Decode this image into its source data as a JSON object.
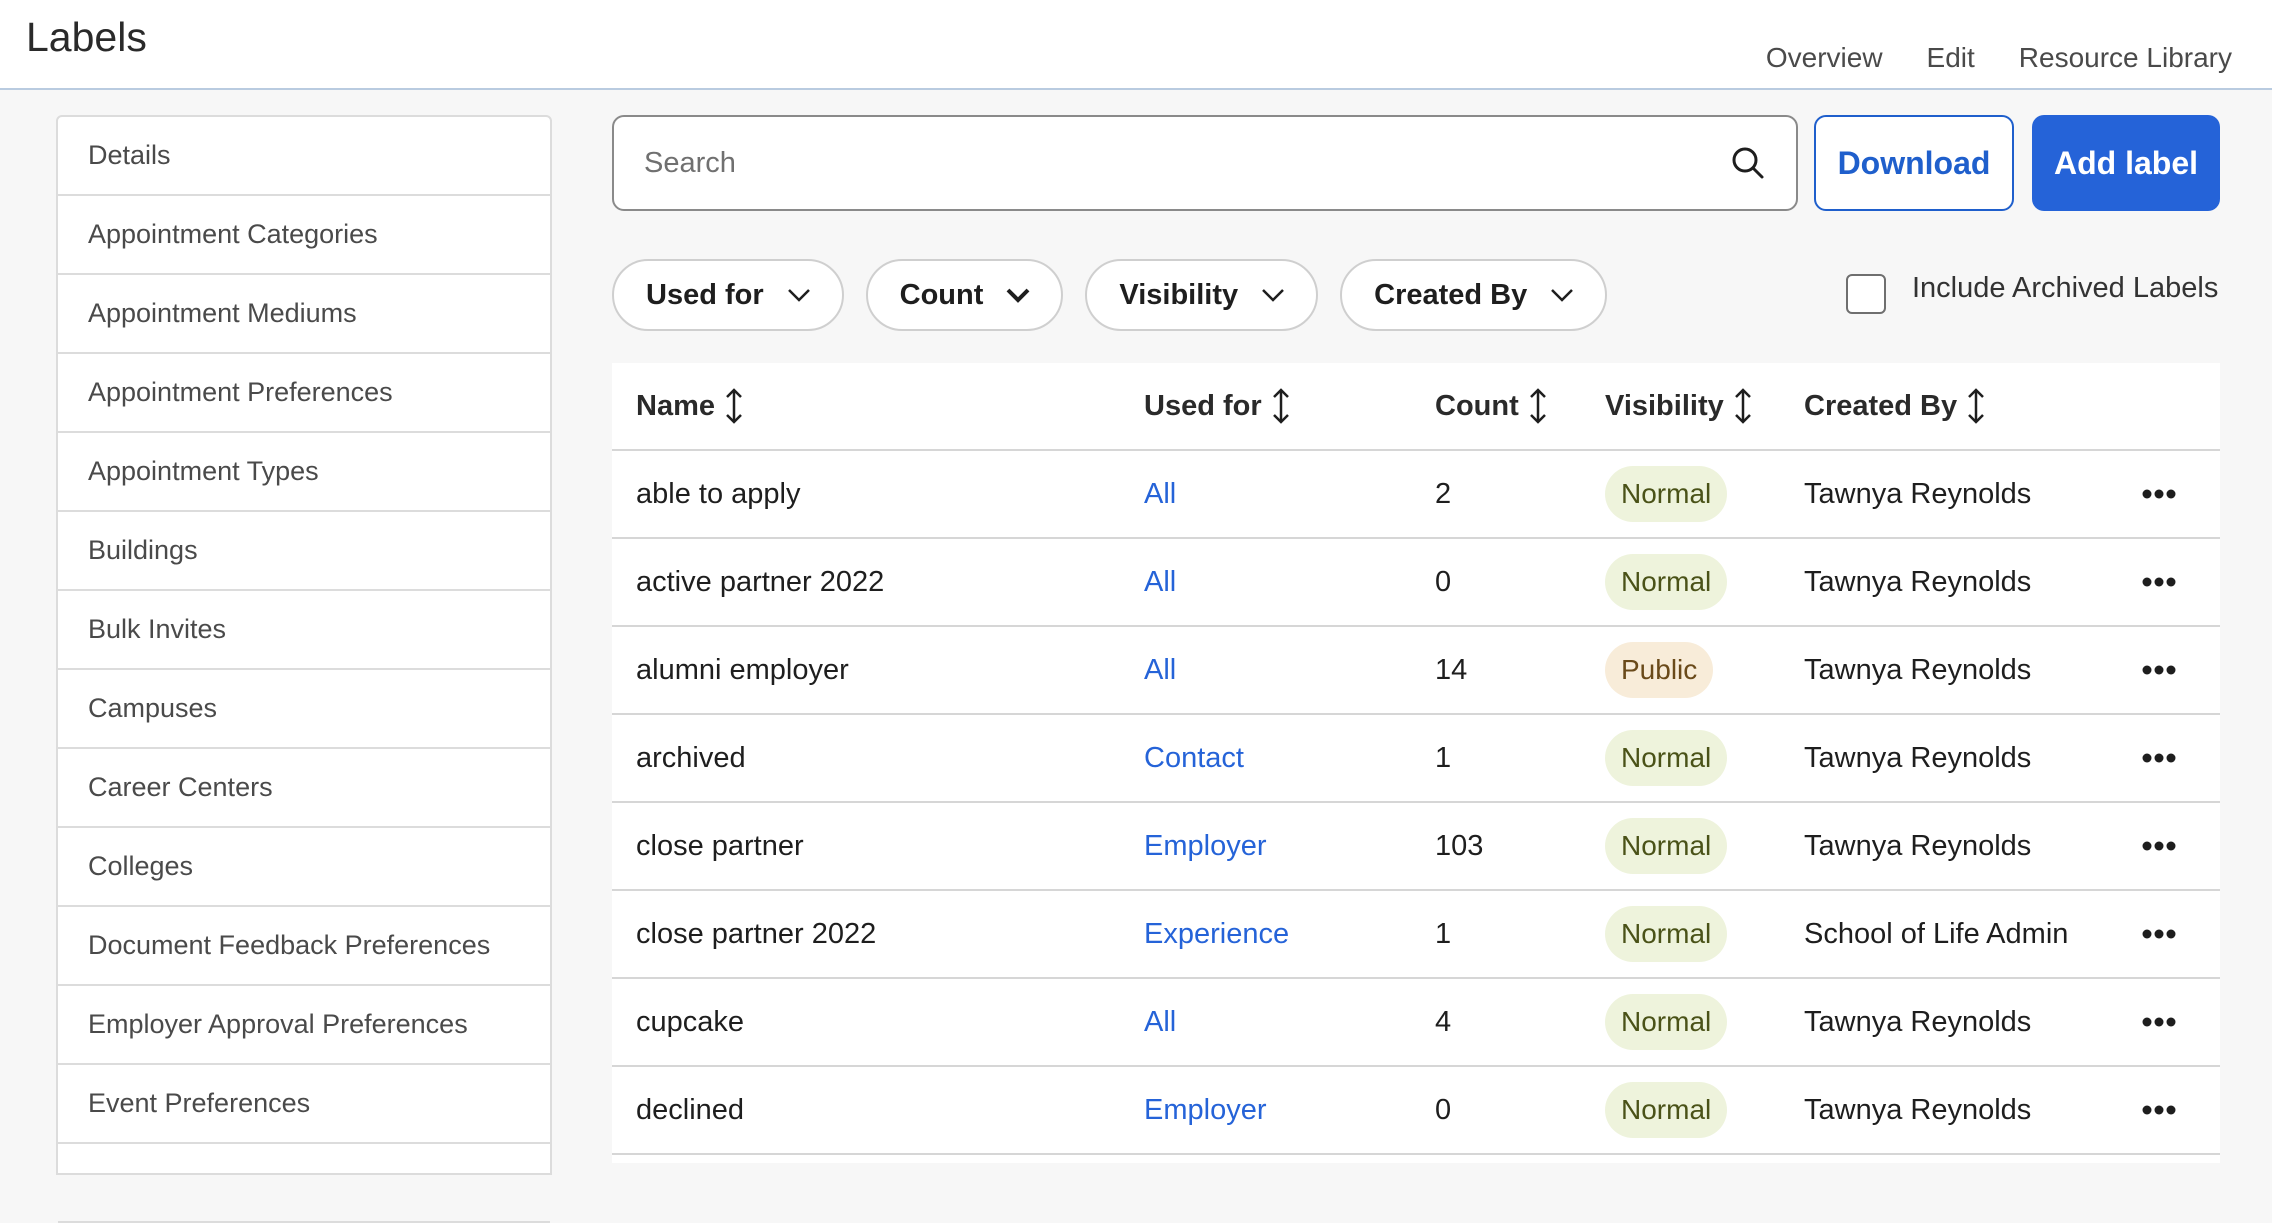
{
  "header": {
    "title": "Labels",
    "nav": [
      "Overview",
      "Edit",
      "Resource Library"
    ]
  },
  "sidebar": {
    "items": [
      "Details",
      "Appointment Categories",
      "Appointment Mediums",
      "Appointment Preferences",
      "Appointment Types",
      "Buildings",
      "Bulk Invites",
      "Campuses",
      "Career Centers",
      "Colleges",
      "Document Feedback Preferences",
      "Employer Approval Preferences",
      "Event Preferences",
      ""
    ]
  },
  "search": {
    "placeholder": "Search",
    "value": ""
  },
  "actions": {
    "download_label": "Download",
    "add_label": "Add label"
  },
  "filters": [
    "Used for",
    "Count",
    "Visibility",
    "Created By"
  ],
  "archived": {
    "label": "Include Archived Labels",
    "checked": false
  },
  "table": {
    "columns": [
      "Name",
      "Used for",
      "Count",
      "Visibility",
      "Created By"
    ],
    "rows": [
      {
        "name": "able to apply",
        "used_for": "All",
        "count": "2",
        "visibility": "Normal",
        "created_by": "Tawnya Reynolds"
      },
      {
        "name": "active partner 2022",
        "used_for": "All",
        "count": "0",
        "visibility": "Normal",
        "created_by": "Tawnya Reynolds"
      },
      {
        "name": "alumni employer",
        "used_for": "All",
        "count": "14",
        "visibility": "Public",
        "created_by": "Tawnya Reynolds"
      },
      {
        "name": "archived",
        "used_for": "Contact",
        "count": "1",
        "visibility": "Normal",
        "created_by": "Tawnya Reynolds"
      },
      {
        "name": "close partner",
        "used_for": "Employer",
        "count": "103",
        "visibility": "Normal",
        "created_by": "Tawnya Reynolds"
      },
      {
        "name": "close partner 2022",
        "used_for": "Experience",
        "count": "1",
        "visibility": "Normal",
        "created_by": "School of Life Admin"
      },
      {
        "name": "cupcake",
        "used_for": "All",
        "count": "4",
        "visibility": "Normal",
        "created_by": "Tawnya Reynolds"
      },
      {
        "name": "declined",
        "used_for": "Employer",
        "count": "0",
        "visibility": "Normal",
        "created_by": "Tawnya Reynolds"
      }
    ]
  },
  "colors": {
    "accent": "#2563d8",
    "badge_normal_bg": "#eef3dc",
    "badge_public_bg": "#f8ecd9"
  }
}
